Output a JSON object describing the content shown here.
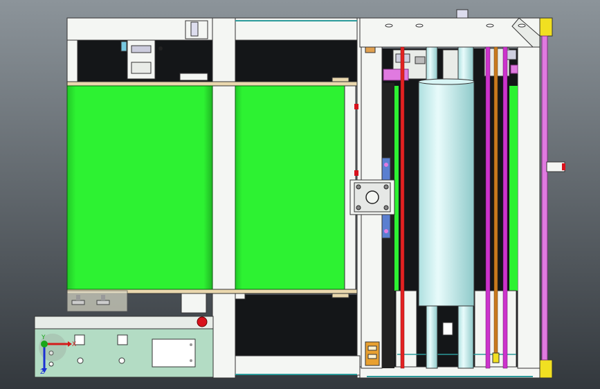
{
  "colors": {
    "bg_top": "#8c949a",
    "bg_bottom": "#33383d",
    "frame": "#f4f6f3",
    "belt": "#2df232",
    "belt_dark": "#169a1c",
    "roller": "#c7eeee",
    "roller_shade": "#8fcaca",
    "shaft_red": "#e32222",
    "shaft_magenta": "#cc33cc",
    "shaft_orange": "#c87a1e",
    "teal": "#2b9a9a",
    "yellow": "#f1e021",
    "panel": "#b3dcc4",
    "pink_rod": "#e07ae0",
    "dark": "#141618",
    "beige": "#ead8ae",
    "blue_block": "#5a7fd0",
    "estop": "#d8121c"
  },
  "axis_triad": {
    "x_label": "X",
    "y_label": "Y",
    "z_label": "Z",
    "x_color": "#d41a1a",
    "y_color": "#1aa61a",
    "z_color": "#1a2fd4",
    "icons": [
      "axis-triad-icon"
    ]
  }
}
